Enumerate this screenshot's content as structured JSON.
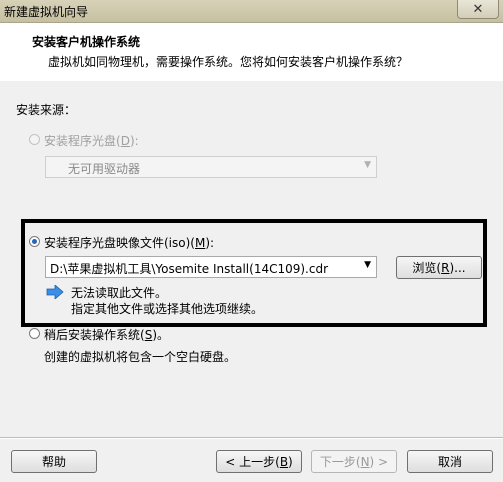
{
  "window": {
    "title": "新建虚拟机向导",
    "close_glyph": "✕"
  },
  "header": {
    "title": "安装客户机操作系统",
    "subtitle": "虚拟机如同物理机，需要操作系统。您将如何安装客户机操作系统？"
  },
  "source_label": "安装来源：",
  "disc": {
    "label": "安装程序光盘(",
    "hotkey": "D",
    "label_end": "):",
    "selected": false,
    "enabled": false,
    "dropdown_value": "无可用驱动器"
  },
  "iso": {
    "label": "安装程序光盘映像文件(iso)(",
    "hotkey": "M",
    "label_end": "):",
    "selected": true,
    "path_value": "D:\\苹果虚拟机工具\\Yosemite Install(14C109).cdr",
    "browse_label": "浏览(",
    "browse_hotkey": "R",
    "browse_end": ")...",
    "message_line1": "无法读取此文件。",
    "message_line2": "指定其他文件或选择其他选项继续。"
  },
  "later": {
    "label": "稍后安装操作系统(",
    "hotkey": "S",
    "label_end": ")。",
    "description": "创建的虚拟机将包含一个空白硬盘。"
  },
  "footer": {
    "help": "帮助",
    "back_label": "< 上一步(",
    "back_hotkey": "B",
    "back_end": ")",
    "next_label": "下一步(",
    "next_hotkey": "N",
    "next_end": ") >",
    "cancel": "取消"
  },
  "colors": {
    "accent": "#2a63b7",
    "info_arrow": "#3a8ee6"
  }
}
